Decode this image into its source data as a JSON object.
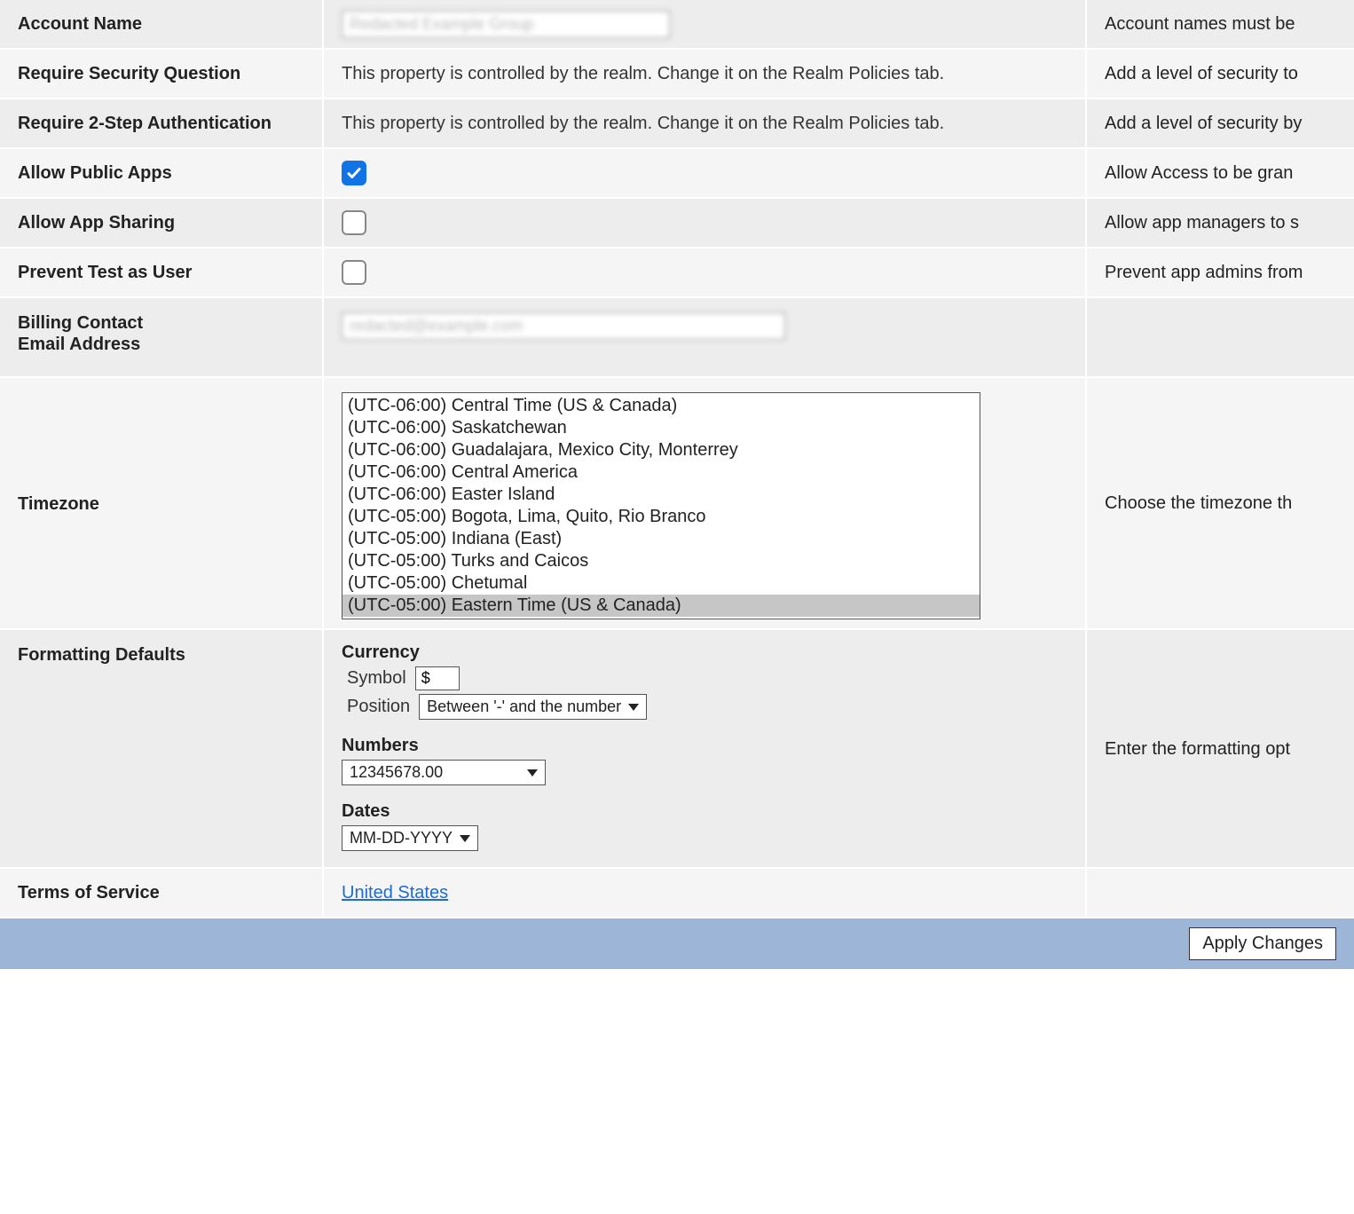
{
  "rows": {
    "account_name": {
      "label": "Account Name",
      "value": "Redacted Example Group",
      "help": "Account names must be"
    },
    "require_sec_q": {
      "label": "Require Security Question",
      "value": "This property is controlled by the realm. Change it on the Realm Policies tab.",
      "help": "Add a level of security to"
    },
    "require_2step": {
      "label": "Require 2-Step Authentication",
      "value": "This property is controlled by the realm. Change it on the Realm Policies tab.",
      "help": "Add a level of security by"
    },
    "allow_public": {
      "label": "Allow Public Apps",
      "checked": true,
      "help": "Allow Access to be gran"
    },
    "allow_sharing": {
      "label": "Allow App Sharing",
      "checked": false,
      "help": "Allow app managers to s"
    },
    "prevent_test": {
      "label": "Prevent Test as User",
      "checked": false,
      "help": "Prevent app admins from"
    },
    "billing": {
      "label": "Billing Contact\nEmail Address",
      "value": "redacted@example.com",
      "help": ""
    },
    "timezone": {
      "label": "Timezone",
      "options": [
        "(UTC-06:00) Central Time (US & Canada)",
        "(UTC-06:00) Saskatchewan",
        "(UTC-06:00) Guadalajara, Mexico City, Monterrey",
        "(UTC-06:00) Central America",
        "(UTC-06:00) Easter Island",
        "(UTC-05:00) Bogota, Lima, Quito, Rio Branco",
        "(UTC-05:00) Indiana (East)",
        "(UTC-05:00) Turks and Caicos",
        "(UTC-05:00) Chetumal",
        "(UTC-05:00) Eastern Time (US & Canada)"
      ],
      "selected_index": 9,
      "help": "Choose the timezone th"
    },
    "formatting": {
      "label": "Formatting Defaults",
      "currency_heading": "Currency",
      "symbol_label": "Symbol",
      "symbol_value": "$",
      "position_label": "Position",
      "position_value": "Between '-' and the number",
      "numbers_heading": "Numbers",
      "numbers_value": "12345678.00",
      "dates_heading": "Dates",
      "dates_value": "MM-DD-YYYY",
      "help": "Enter the formatting opt"
    },
    "tos": {
      "label": "Terms of Service",
      "link_text": "United States",
      "help": ""
    }
  },
  "footer": {
    "apply_label": "Apply Changes"
  }
}
